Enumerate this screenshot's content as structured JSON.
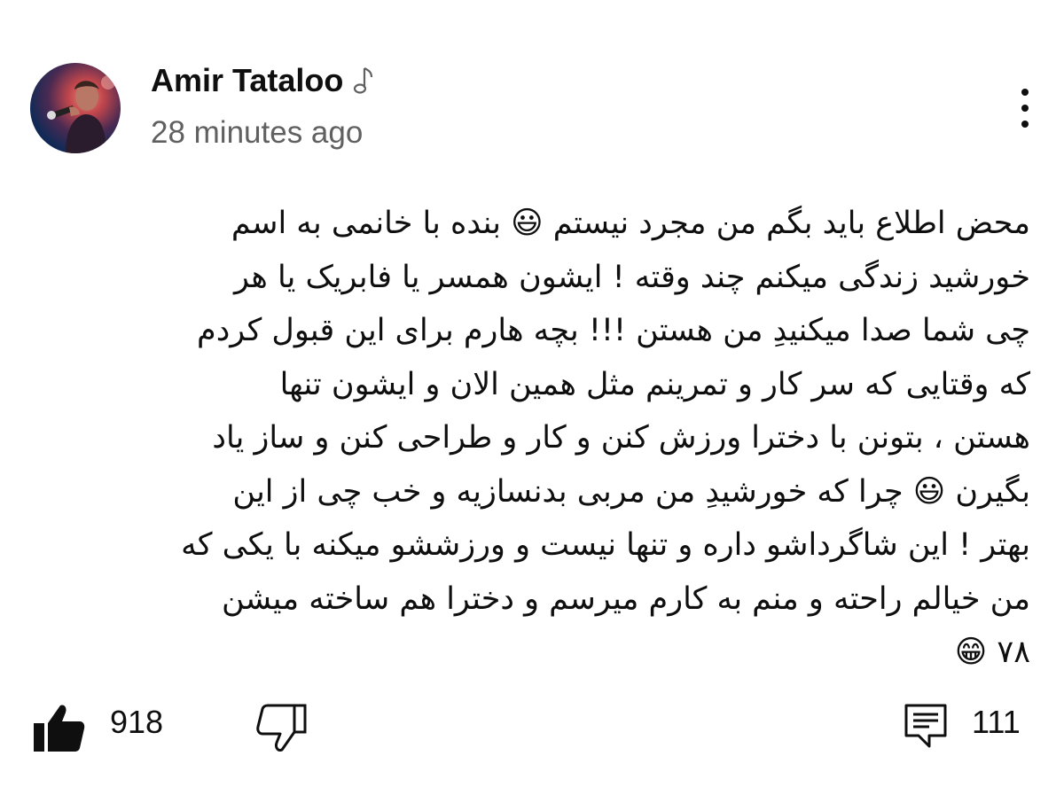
{
  "post": {
    "author": "Amir Tataloo",
    "author_badge_icon": "music-note-icon",
    "timestamp": "28 minutes ago",
    "body_lines": [
      "محض اطلاع باید بگم من مجرد نیستم 😃 بنده با خانمی به اسم",
      "خورشید زندگی میکنم چند وقته ! ایشون همسر یا فابریک یا هر",
      "چی شما صدا میکنیدِ من هستن !!! بچه هارم برای این قبول کردم",
      "که وقتایی که سر کار و تمرینم مثل همین الان و ایشون تنها",
      "هستن ، بتونن با دخترا ورزش کنن و کار و طراحی کنن و ساز یاد",
      "بگیرن 😃 چرا که خورشیدِ من مربی بدنسازیه و خب چی از این",
      "بهتر ! این شاگرداشو داره و تنها نیست و ورزششو میکنه با یکی که",
      "من خیالم راحته و منم به کارم میرسم و دخترا هم ساخته میشن",
      "۷۸ 😁"
    ]
  },
  "actions": {
    "like_icon": "thumbs-up-filled-icon",
    "like_count": "918",
    "dislike_icon": "thumbs-down-icon",
    "comment_icon": "comment-icon",
    "comment_count": "111"
  },
  "menu": {
    "icon": "more-vertical-icon"
  }
}
